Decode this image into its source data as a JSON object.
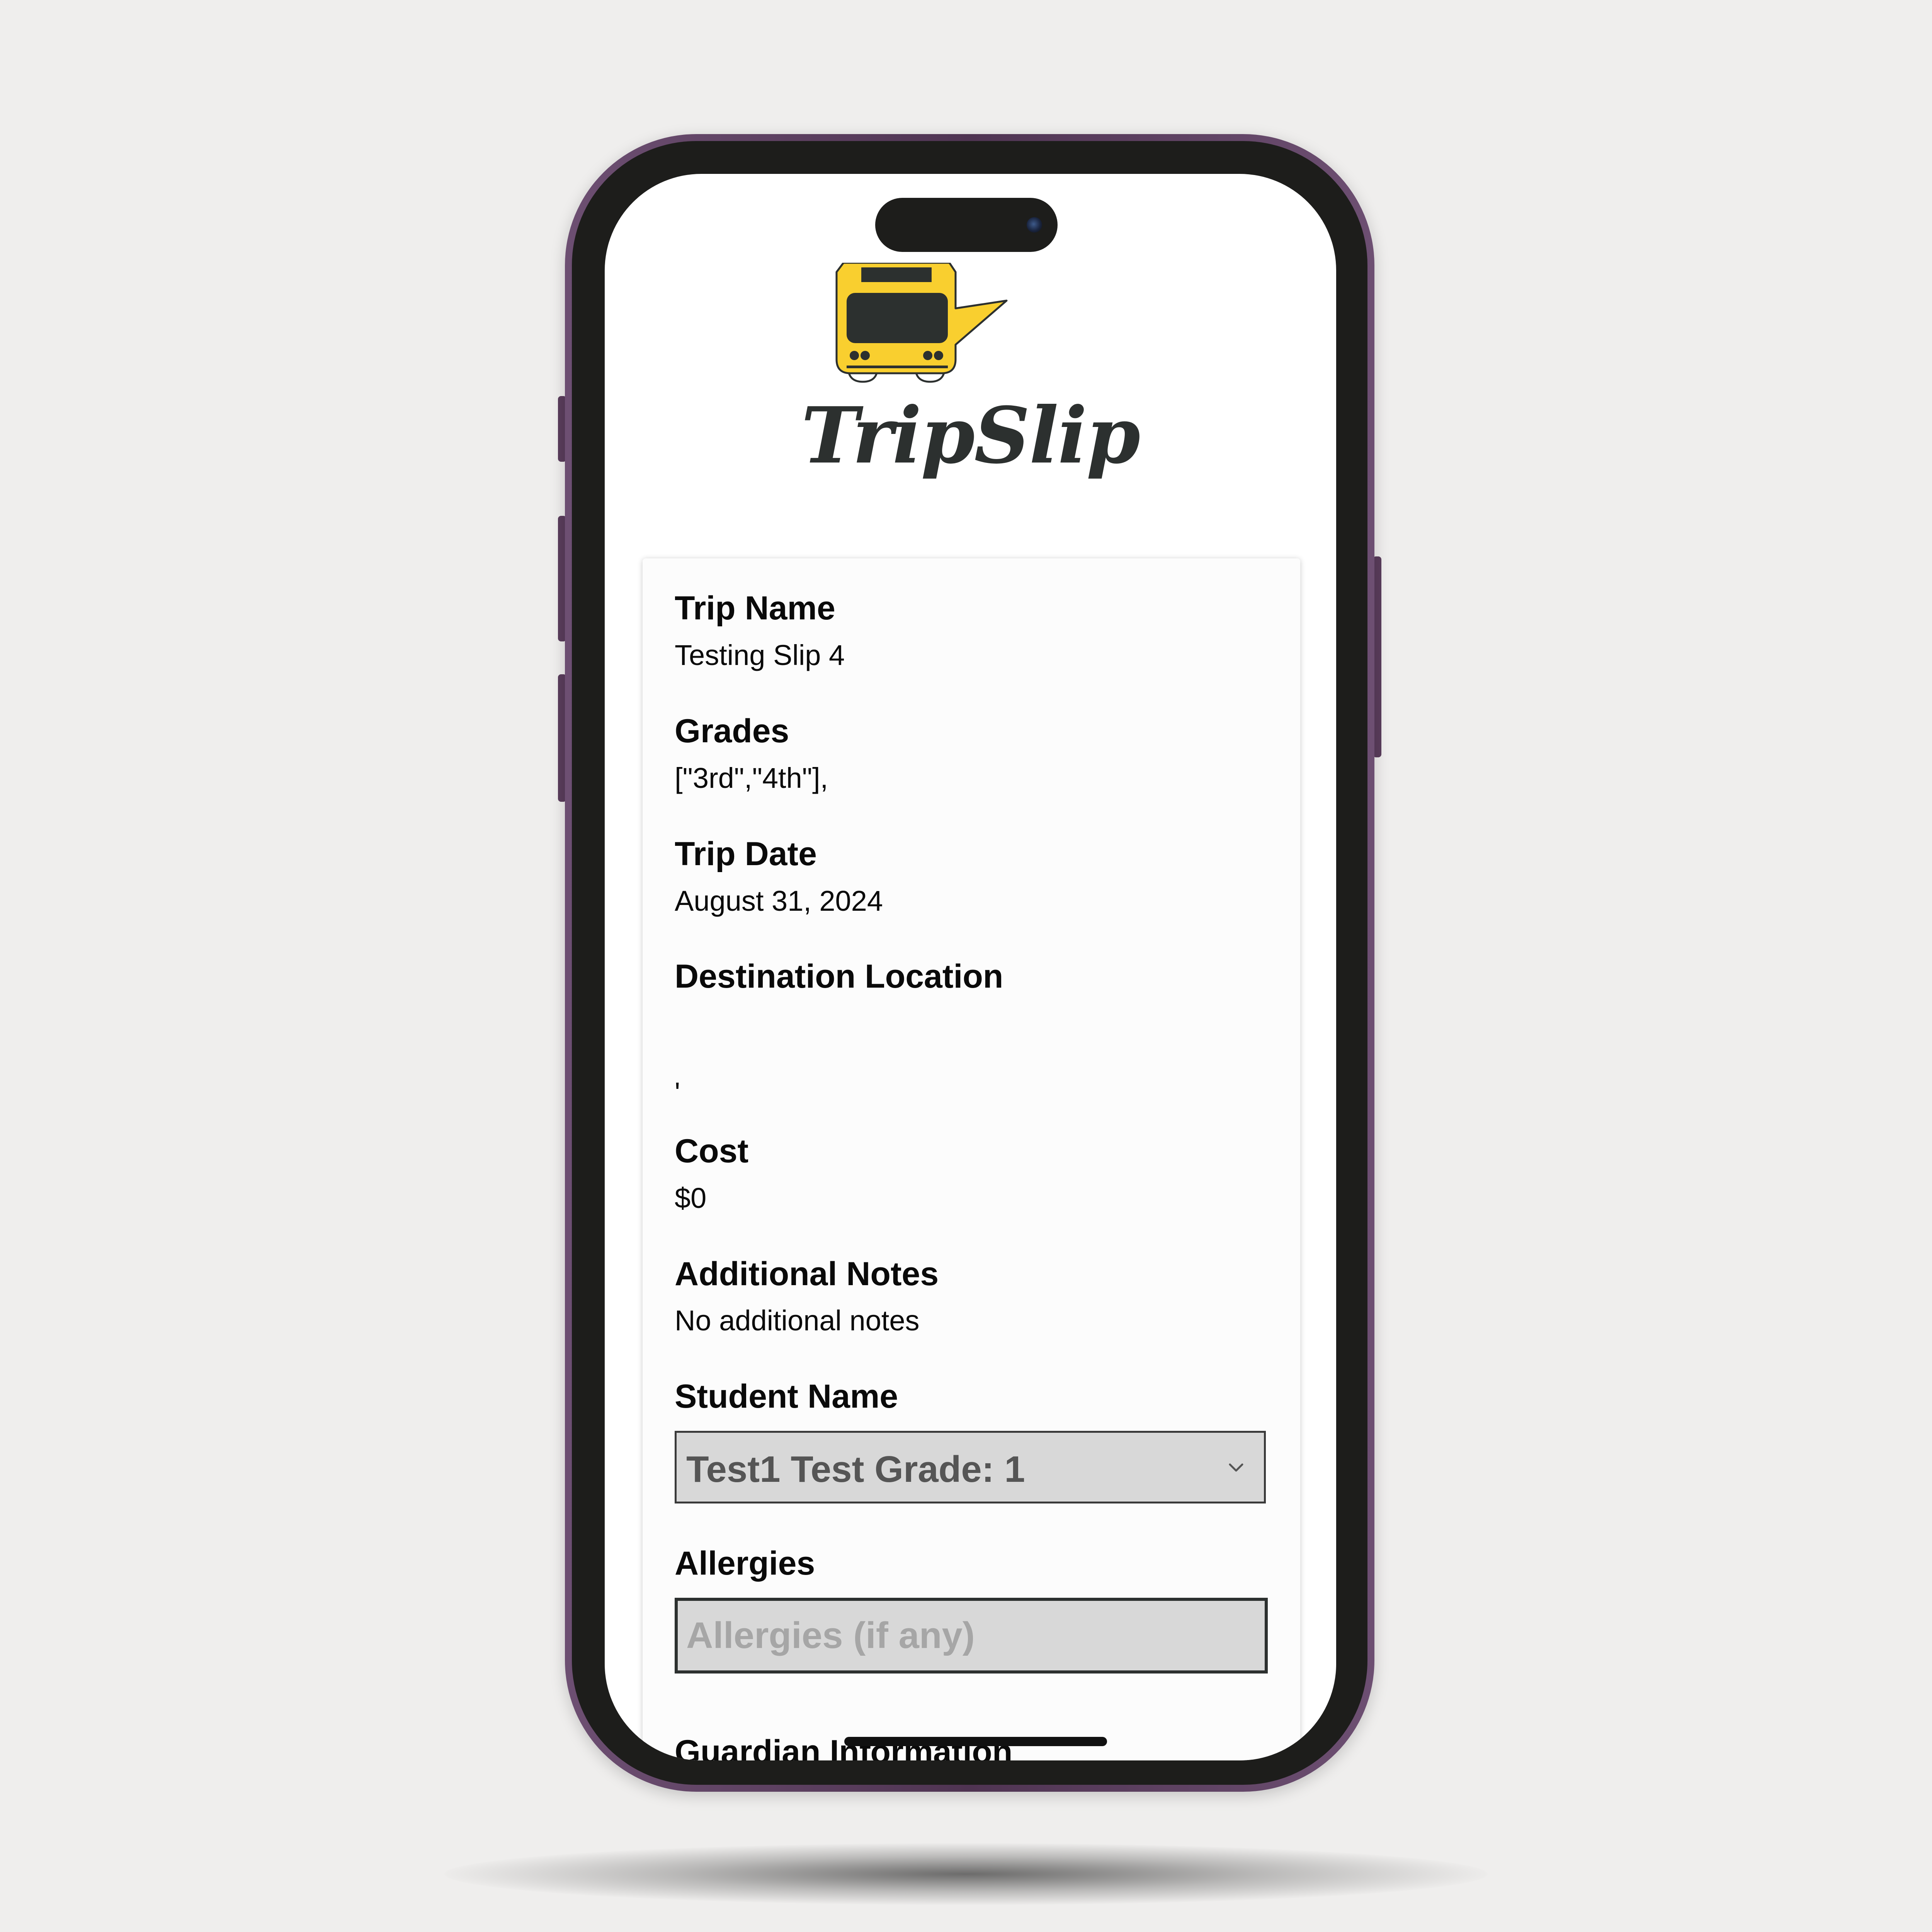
{
  "app": {
    "brand_name": "TripSlip",
    "logo_icon": "school-bus-speech-bubble-icon",
    "colors": {
      "bus_yellow": "#f9cf2f",
      "dark": "#2c302f",
      "phone_frame": "#5a3d5c"
    }
  },
  "form": {
    "trip_name": {
      "label": "Trip Name",
      "value": "Testing Slip 4"
    },
    "grades": {
      "label": "Grades",
      "value": "[\"3rd\",\"4th\"],"
    },
    "trip_date": {
      "label": "Trip Date",
      "value": "August 31, 2024"
    },
    "destination": {
      "label": "Destination Location",
      "value": "'"
    },
    "cost": {
      "label": "Cost",
      "value": "$0"
    },
    "notes": {
      "label": "Additional Notes",
      "value": "No additional notes"
    },
    "student": {
      "label": "Student Name",
      "selected": "Test1 Test Grade: 1"
    },
    "allergies": {
      "label": "Allergies",
      "placeholder": "Allergies (if any)",
      "value": ""
    },
    "guardian": {
      "label": "Guardian Information"
    }
  }
}
